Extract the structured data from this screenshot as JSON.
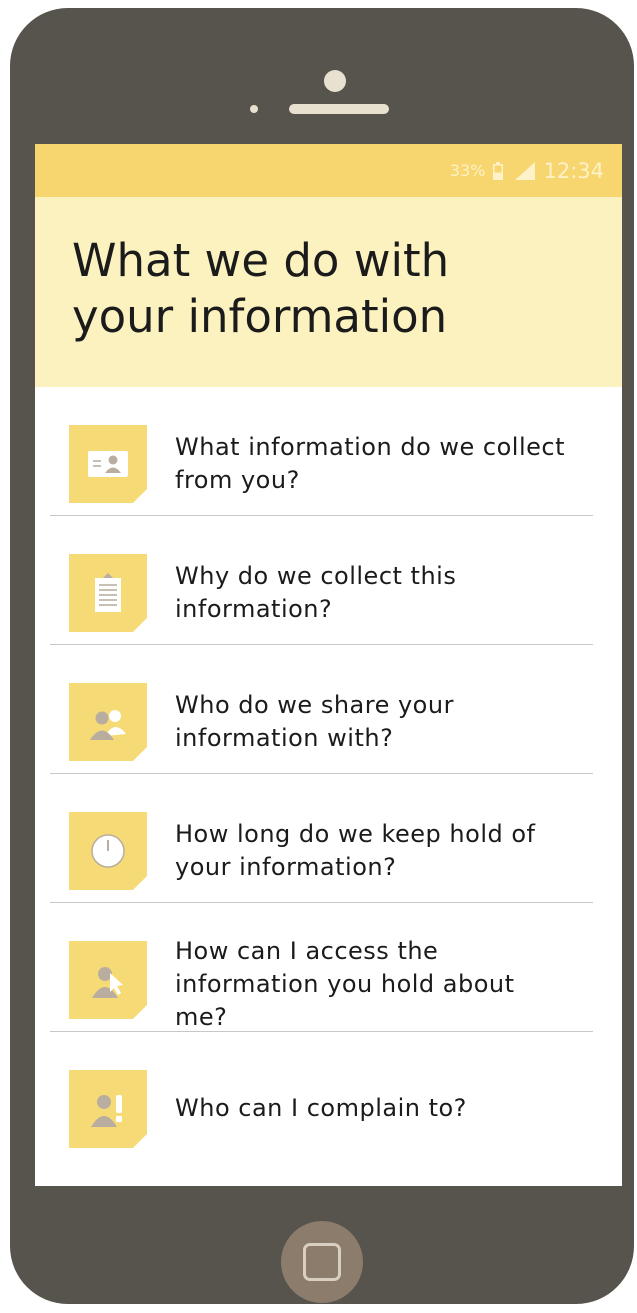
{
  "status_bar": {
    "battery_percent": "33%",
    "battery_icon": "battery-icon",
    "signal_icon": "signal-icon",
    "time": "12:34"
  },
  "header": {
    "title": "What we do with your information"
  },
  "menu": {
    "items": [
      {
        "label": "What information do we collect from you?",
        "icon": "id-card-icon"
      },
      {
        "label": "Why do we collect this information?",
        "icon": "clipboard-icon"
      },
      {
        "label": "Who do we share your information with?",
        "icon": "people-icon"
      },
      {
        "label": "How long do we keep hold of your information?",
        "icon": "clock-icon"
      },
      {
        "label": "How can I access the information you hold about me?",
        "icon": "user-pointer-icon"
      },
      {
        "label": "Who can I complain to?",
        "icon": "user-alert-icon"
      }
    ]
  },
  "colors": {
    "phone_body": "#57544d",
    "status_bar": "#f7d56f",
    "header_bg": "#fcf2c0",
    "tile": "#f6da76",
    "icon_fill": "#b9ada0",
    "home_button": "#8b7c6c"
  }
}
